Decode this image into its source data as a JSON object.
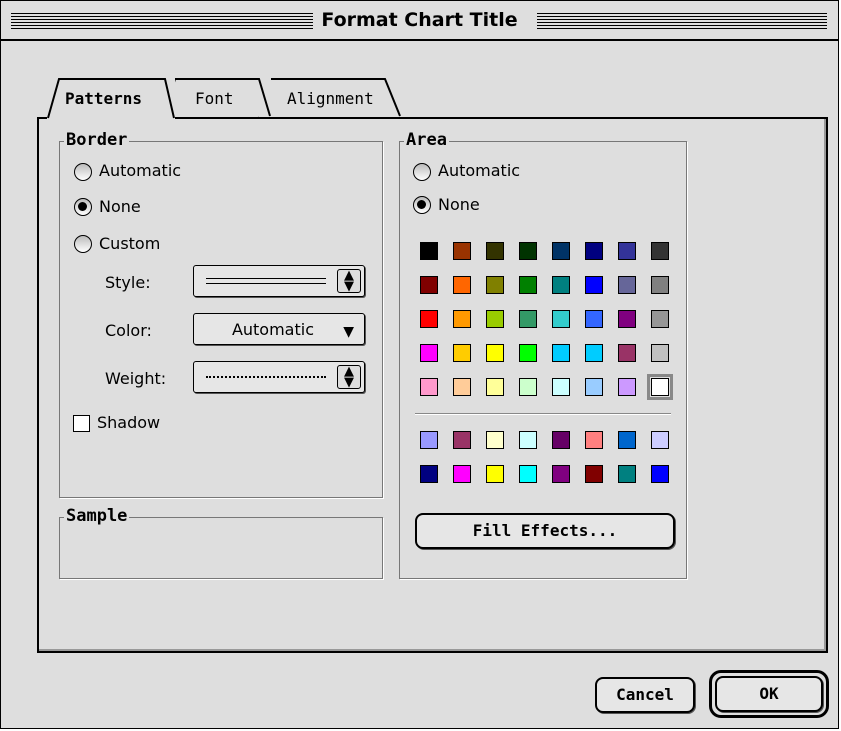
{
  "window": {
    "title": "Format Chart Title"
  },
  "tabs": [
    {
      "label": "Patterns",
      "active": true
    },
    {
      "label": "Font",
      "active": false
    },
    {
      "label": "Alignment",
      "active": false
    }
  ],
  "border": {
    "group_title": "Border",
    "options": [
      {
        "label": "Automatic",
        "selected": false
      },
      {
        "label": "None",
        "selected": true
      },
      {
        "label": "Custom",
        "selected": false
      }
    ],
    "style_label": "Style:",
    "color_label": "Color:",
    "color_value": "Automatic",
    "weight_label": "Weight:",
    "shadow_label": "Shadow",
    "shadow_checked": false
  },
  "sample": {
    "group_title": "Sample"
  },
  "area": {
    "group_title": "Area",
    "options": [
      {
        "label": "Automatic",
        "selected": false
      },
      {
        "label": "None",
        "selected": true
      }
    ],
    "palette_main": [
      [
        "#000000",
        "#993300",
        "#333300",
        "#003300",
        "#003366",
        "#000080",
        "#333399",
        "#333333"
      ],
      [
        "#800000",
        "#FF6600",
        "#808000",
        "#008000",
        "#008080",
        "#0000FF",
        "#666699",
        "#808080"
      ],
      [
        "#FF0000",
        "#FF9900",
        "#99CC00",
        "#339966",
        "#33CCCC",
        "#3366FF",
        "#800080",
        "#969696"
      ],
      [
        "#FF00FF",
        "#FFCC00",
        "#FFFF00",
        "#00FF00",
        "#00CCFF",
        "#00CCFF",
        "#993366",
        "#C0C0C0"
      ],
      [
        "#FF99CC",
        "#FFCC99",
        "#FFFF99",
        "#CCFFCC",
        "#CCFFFF",
        "#99CCFF",
        "#CC99FF",
        "#FFFFFF"
      ]
    ],
    "palette_chart": [
      [
        "#9999FF",
        "#993366",
        "#FFFFCC",
        "#CCFFFF",
        "#660066",
        "#FF8080",
        "#0066CC",
        "#CCCCFF"
      ],
      [
        "#000080",
        "#FF00FF",
        "#FFFF00",
        "#00FFFF",
        "#800080",
        "#800000",
        "#008080",
        "#0000FF"
      ]
    ],
    "fill_effects_label": "Fill Effects..."
  },
  "buttons": {
    "cancel": "Cancel",
    "ok": "OK"
  }
}
